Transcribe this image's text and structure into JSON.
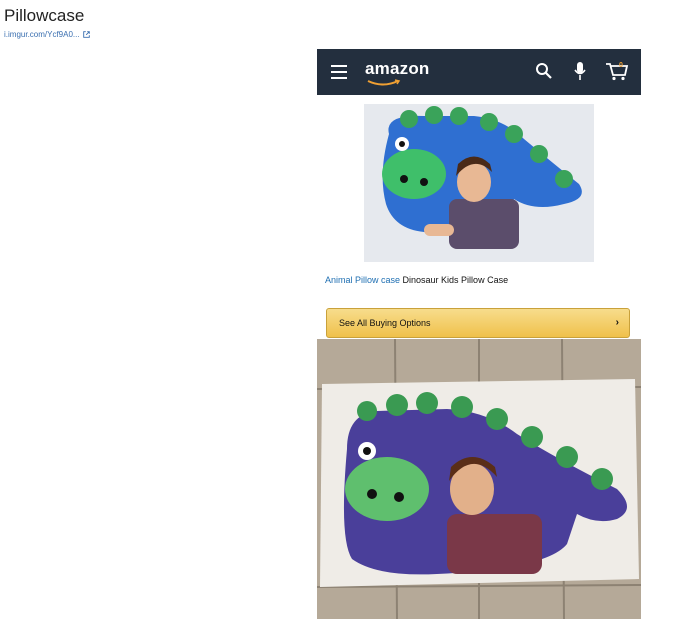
{
  "post": {
    "title": "Pillowcase",
    "link_text": "i.imgur.com/Ycf9A0..."
  },
  "amazon": {
    "logo_text": "amazon",
    "product_link": "Animal Pillow case",
    "product_rest": " Dinosaur Kids Pillow Case",
    "buy_button_label": "See All Buying Options",
    "cart_count": "0",
    "colors": {
      "navbar": "#232f3e",
      "accent": "#f0a033",
      "button": "#f0c14b",
      "link": "#1f6fb2"
    },
    "icons": [
      "hamburger-menu-icon",
      "search-icon",
      "microphone-icon",
      "cart-icon",
      "chevron-right-icon"
    ]
  }
}
